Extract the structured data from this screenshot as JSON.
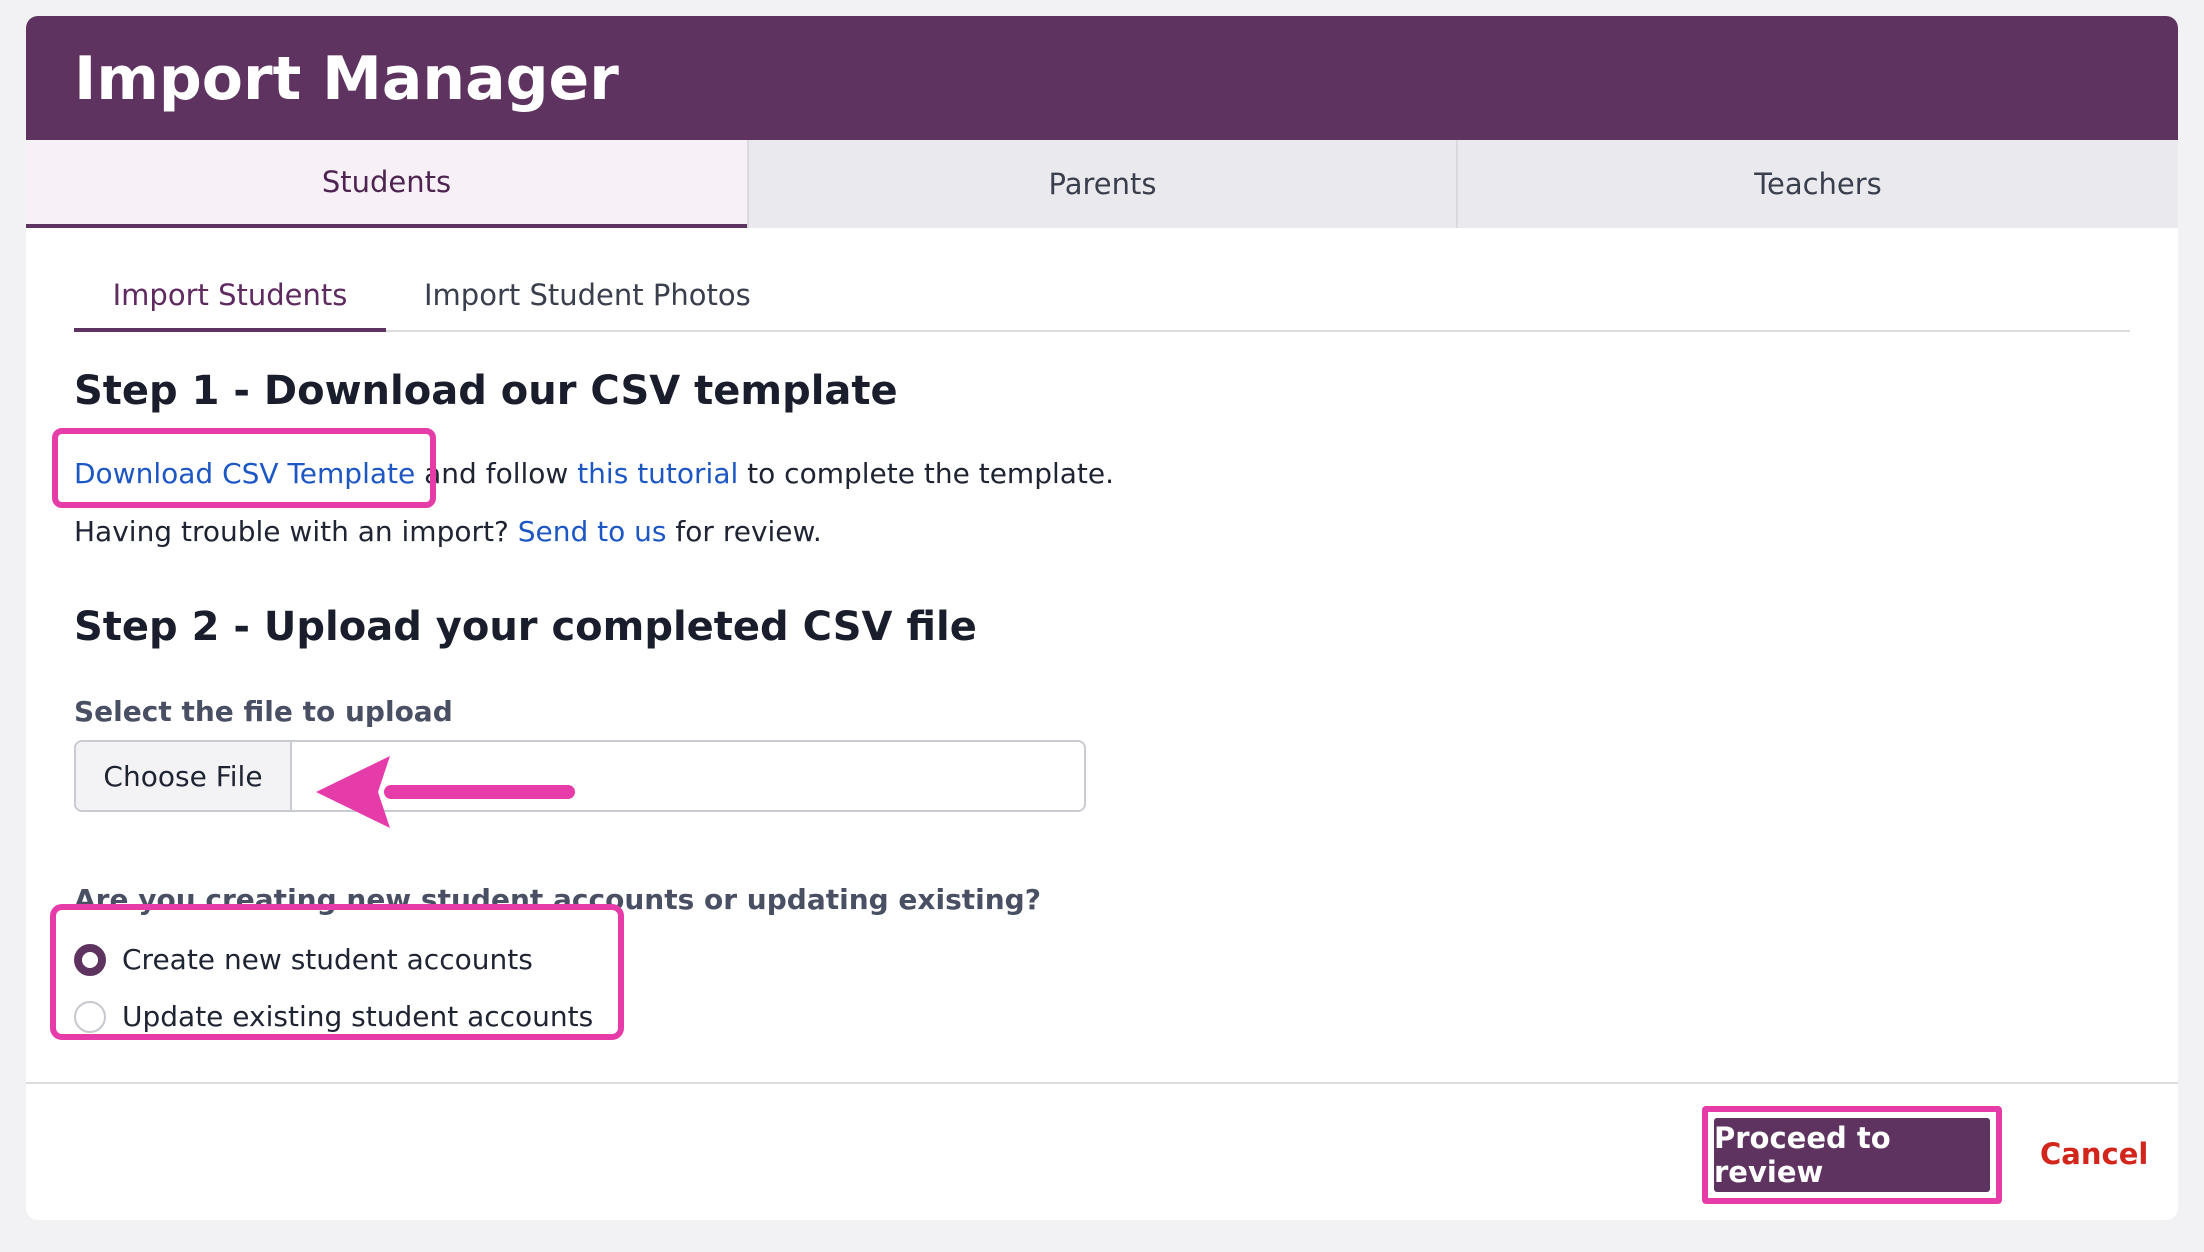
{
  "header": {
    "title": "Import Manager"
  },
  "tabs": [
    {
      "label": "Students",
      "active": true
    },
    {
      "label": "Parents",
      "active": false
    },
    {
      "label": "Teachers",
      "active": false
    }
  ],
  "subtabs": [
    {
      "label": "Import Students",
      "active": true
    },
    {
      "label": "Import Student Photos",
      "active": false
    }
  ],
  "step1": {
    "heading": "Step 1 - Download our CSV template",
    "download_link": "Download CSV Template",
    "text_and_follow": "and follow",
    "tutorial_link": "this tutorial",
    "text_complete": "to complete the template.",
    "trouble_text": "Having trouble with an import?",
    "send_link": "Send to us",
    "review_text": "for review."
  },
  "step2": {
    "heading": "Step 2 - Upload your completed CSV file",
    "file_label": "Select the file to upload",
    "choose_file": "Choose File",
    "question": "Are you creating new student accounts or updating existing?",
    "options": [
      {
        "label": "Create new student accounts",
        "checked": true
      },
      {
        "label": "Update existing student accounts",
        "checked": false
      }
    ]
  },
  "footer": {
    "proceed_label": "Proceed to review",
    "cancel_label": "Cancel"
  },
  "colors": {
    "brand": "#5e3360",
    "link": "#1d57c4",
    "cancel": "#d2261c",
    "annotation": "#e63ca9"
  }
}
